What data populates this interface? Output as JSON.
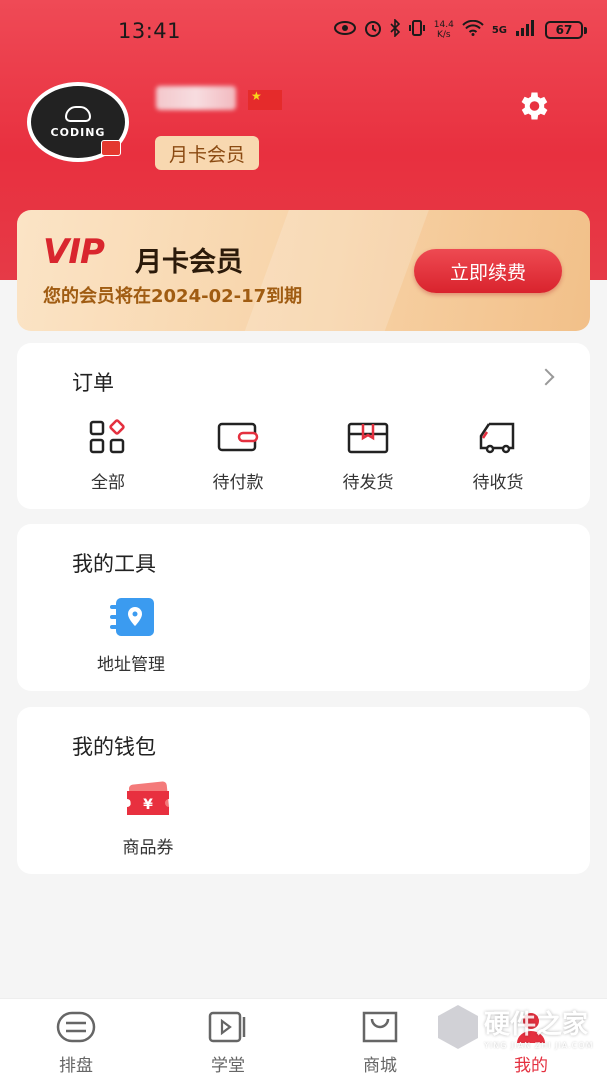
{
  "status_bar": {
    "time": "13:41",
    "net_speed_value": "14.4",
    "net_speed_unit": "K/s",
    "signal_label": "5G",
    "battery": "67"
  },
  "profile": {
    "avatar_text": "CODING",
    "member_badge": "月卡会员",
    "settings_icon": "gear-icon"
  },
  "vip": {
    "logo": "VIP",
    "title": "月卡会员",
    "expire_text": "您的会员将在2024-02-17到期",
    "renew_label": "立即续费"
  },
  "orders": {
    "title": "订单",
    "items": [
      {
        "label": "全部",
        "icon": "grid-icon"
      },
      {
        "label": "待付款",
        "icon": "wallet-icon"
      },
      {
        "label": "待发货",
        "icon": "package-icon"
      },
      {
        "label": "待收货",
        "icon": "truck-icon"
      }
    ]
  },
  "tools": {
    "title": "我的工具",
    "items": [
      {
        "label": "地址管理",
        "icon": "address-book-icon"
      }
    ]
  },
  "wallet": {
    "title": "我的钱包",
    "items": [
      {
        "label": "商品券",
        "icon": "coupon-icon"
      }
    ]
  },
  "tabbar": {
    "items": [
      {
        "label": "排盘",
        "icon": "chart-icon"
      },
      {
        "label": "学堂",
        "icon": "video-icon"
      },
      {
        "label": "商城",
        "icon": "shopping-bag-icon"
      },
      {
        "label": "我的",
        "icon": "user-icon"
      }
    ],
    "active_color": "#e4303f"
  },
  "watermark": {
    "text": "硬件之家",
    "sub": "YING JIAN ZHI JIA.COM"
  },
  "colors": {
    "brand_red": "#e8303f",
    "vip_gold": "#f7d2a6"
  }
}
